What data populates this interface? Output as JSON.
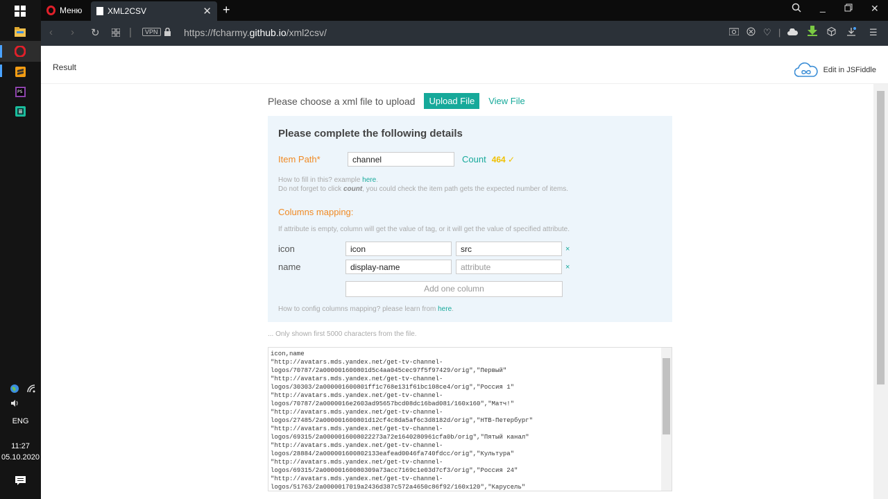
{
  "taskbar": {
    "lang": "ENG",
    "time": "11:27",
    "date": "05.10.2020"
  },
  "browser": {
    "menu_label": "Меню",
    "tab_title": "XML2CSV",
    "url_prefix": "https://fcharmy.",
    "url_domain": "github.io",
    "url_path": "/xml2csv/",
    "vpn_label": "VPN"
  },
  "fiddle": {
    "result_label": "Result",
    "edit_link": "Edit in JSFiddle"
  },
  "upload": {
    "prompt": "Please choose a xml file to upload",
    "upload_button": "Upload File",
    "view_link": "View File"
  },
  "details": {
    "heading": "Please complete the following details",
    "item_path_label": "Item Path*",
    "item_path_value": "channel",
    "count_label": "Count",
    "count_value": "464 ✓",
    "hint_line1_prefix": "How to fill in this? example ",
    "hint_line1_link": "here",
    "hint_line1_suffix": ".",
    "hint_line2_prefix": "Do not forget to click ",
    "hint_line2_em": "count",
    "hint_line2_suffix": ", you could check the item path gets the expected number of items.",
    "columns_title": "Columns mapping:",
    "columns_hint": "If attribute is empty, column will get the value of tag, or it will get the value of specified attribute.",
    "rows": [
      {
        "name": "icon",
        "tag": "icon",
        "attribute": "src",
        "attribute_placeholder": "attribute"
      },
      {
        "name": "name",
        "tag": "display-name",
        "attribute": "",
        "attribute_placeholder": "attribute"
      }
    ],
    "remove_symbol": "×",
    "add_column": "Add one column",
    "config_hint_prefix": "How to config columns mapping? please learn from ",
    "config_hint_link": "here",
    "config_hint_suffix": "."
  },
  "output": {
    "note": "... Only shown first 5000 characters from the file.",
    "text": "icon,name\n\"http://avatars.mds.yandex.net/get-tv-channel-\nlogos/70787/2a000001600801d5c4aa045cec97f5f97429/orig\",\"Первый\"\n\"http://avatars.mds.yandex.net/get-tv-channel-\nlogos/30303/2a000001600801ff1c768e131f61bc108ce4/orig\",\"Россия 1\"\n\"http://avatars.mds.yandex.net/get-tv-channel-\nlogos/70787/2a0000016e2603ad95657bcd08dc16bad081/160x160\",\"Матч!\"\n\"http://avatars.mds.yandex.net/get-tv-channel-\nlogos/27485/2a000001600801d12cf4c8da5af6c3d8182d/orig\",\"НТВ-Петербург\"\n\"http://avatars.mds.yandex.net/get-tv-channel-\nlogos/69315/2a0000016008022273a72e1640280961cfa0b/orig\",\"Пятый канал\"\n\"http://avatars.mds.yandex.net/get-tv-channel-\nlogos/28884/2a000001600802133eafead0046fa740fdcc/orig\",\"Культура\"\n\"http://avatars.mds.yandex.net/get-tv-channel-\nlogos/69315/2a00000160080309a73acc7169c1e03d7cf3/orig\",\"Россия 24\"\n\"http://avatars.mds.yandex.net/get-tv-channel-\nlogos/51763/2a0000017019a2436d387c572a4650c86f92/160x120\",\"Карусель\""
  },
  "colors": {
    "accent": "#16a99a",
    "orange": "#f08a24",
    "count": "#f0c000",
    "panel_bg": "#edf5fb"
  }
}
